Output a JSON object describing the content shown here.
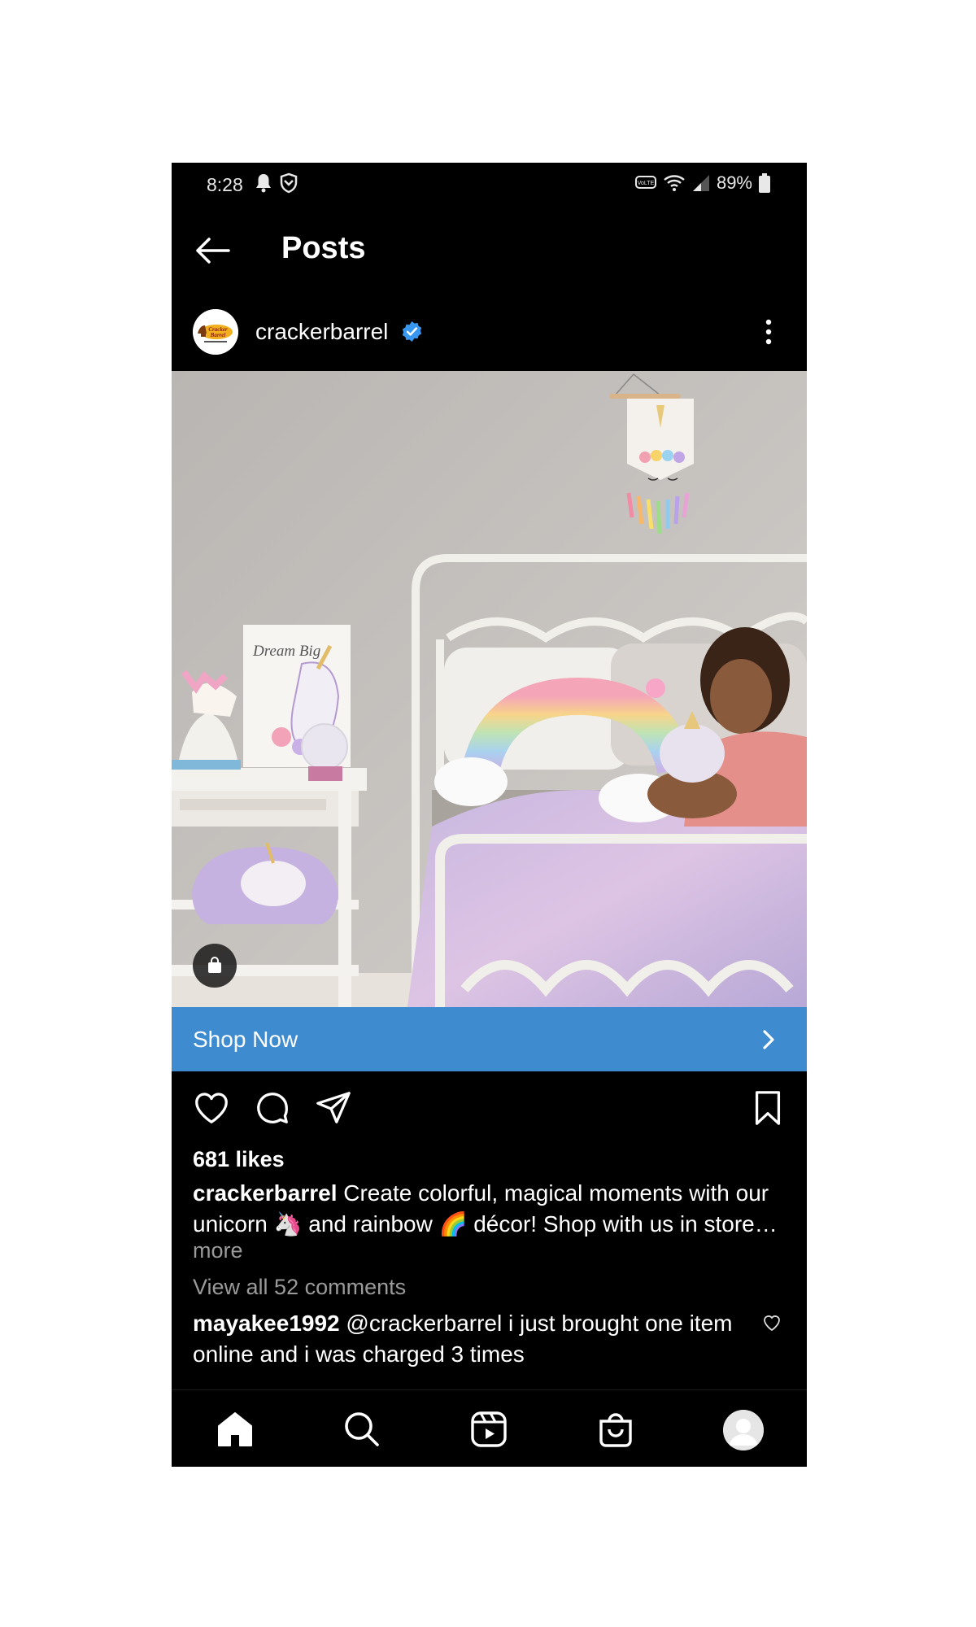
{
  "status_bar": {
    "time": "8:28",
    "battery": "89%",
    "icons_left": [
      "bell-icon",
      "shield-icon"
    ],
    "icons_right": [
      "volte-icon",
      "wifi-icon",
      "signal-icon",
      "battery-icon"
    ]
  },
  "header": {
    "title": "Posts"
  },
  "post": {
    "username": "crackerbarrel",
    "verified": true,
    "image_description": "Child on white metal bed with unicorn and rainbow decor",
    "poster_text": "Dream Big",
    "cta": {
      "label": "Shop Now"
    },
    "likes": "681 likes",
    "caption_user": "crackerbarrel",
    "caption_text": " Create colorful, magical moments with our unicorn 🦄 and rainbow 🌈 décor! Shop with us in store…",
    "more": "more",
    "view_comments": "View all 52 comments",
    "comment": {
      "user": "mayakee1992",
      "text": " @crackerbarrel i just brought one item online and i was charged 3 times"
    }
  },
  "nav": [
    "home-icon",
    "search-icon",
    "reels-icon",
    "shop-icon",
    "profile-avatar"
  ],
  "colors": {
    "accent": "#3e8bcf",
    "verified": "#3897f0",
    "background": "#000000"
  }
}
